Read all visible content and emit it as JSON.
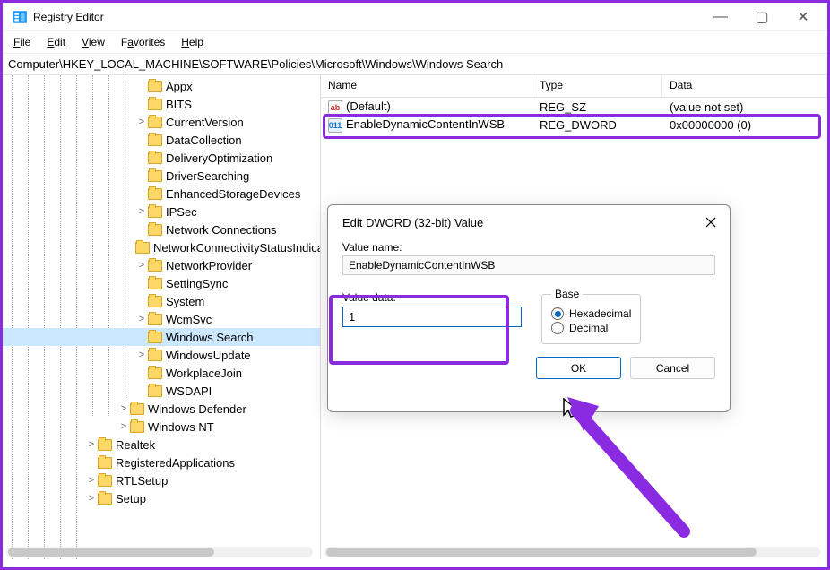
{
  "window": {
    "title": "Registry Editor",
    "min_icon": "—",
    "max_icon": "▢",
    "close_icon": "✕"
  },
  "menu": {
    "file": "File",
    "edit": "Edit",
    "view": "View",
    "favorites": "Favorites",
    "help": "Help"
  },
  "path": "Computer\\HKEY_LOCAL_MACHINE\\SOFTWARE\\Policies\\Microsoft\\Windows\\Windows Search",
  "tree": [
    {
      "indent": 148,
      "toggle": "",
      "label": "Appx"
    },
    {
      "indent": 148,
      "toggle": "",
      "label": "BITS"
    },
    {
      "indent": 148,
      "toggle": ">",
      "label": "CurrentVersion"
    },
    {
      "indent": 148,
      "toggle": "",
      "label": "DataCollection"
    },
    {
      "indent": 148,
      "toggle": "",
      "label": "DeliveryOptimization"
    },
    {
      "indent": 148,
      "toggle": "",
      "label": "DriverSearching"
    },
    {
      "indent": 148,
      "toggle": "",
      "label": "EnhancedStorageDevices"
    },
    {
      "indent": 148,
      "toggle": ">",
      "label": "IPSec"
    },
    {
      "indent": 148,
      "toggle": "",
      "label": "Network Connections"
    },
    {
      "indent": 148,
      "toggle": "",
      "label": "NetworkConnectivityStatusIndicator"
    },
    {
      "indent": 148,
      "toggle": ">",
      "label": "NetworkProvider"
    },
    {
      "indent": 148,
      "toggle": "",
      "label": "SettingSync"
    },
    {
      "indent": 148,
      "toggle": "",
      "label": "System"
    },
    {
      "indent": 148,
      "toggle": ">",
      "label": "WcmSvc"
    },
    {
      "indent": 148,
      "toggle": "",
      "label": "Windows Search",
      "selected": true
    },
    {
      "indent": 148,
      "toggle": ">",
      "label": "WindowsUpdate"
    },
    {
      "indent": 148,
      "toggle": "",
      "label": "WorkplaceJoin"
    },
    {
      "indent": 148,
      "toggle": "",
      "label": "WSDAPI"
    },
    {
      "indent": 128,
      "toggle": ">",
      "label": "Windows Defender"
    },
    {
      "indent": 128,
      "toggle": ">",
      "label": "Windows NT"
    },
    {
      "indent": 92,
      "toggle": ">",
      "label": "Realtek"
    },
    {
      "indent": 92,
      "toggle": "",
      "label": "RegisteredApplications"
    },
    {
      "indent": 92,
      "toggle": ">",
      "label": "RTLSetup"
    },
    {
      "indent": 92,
      "toggle": ">",
      "label": "Setup"
    }
  ],
  "list": {
    "headers": {
      "name": "Name",
      "type": "Type",
      "data": "Data"
    },
    "rows": [
      {
        "icon": "ab",
        "name": "(Default)",
        "type": "REG_SZ",
        "data": "(value not set)"
      },
      {
        "icon": "num",
        "name": "EnableDynamicContentInWSB",
        "type": "REG_DWORD",
        "data": "0x00000000 (0)",
        "highlighted": true
      }
    ]
  },
  "dialog": {
    "title": "Edit DWORD (32-bit) Value",
    "value_name_label": "Value name:",
    "value_name": "EnableDynamicContentInWSB",
    "value_data_label": "Value data:",
    "value_data": "1",
    "base_label": "Base",
    "hex_label": "Hexadecimal",
    "dec_label": "Decimal",
    "ok": "OK",
    "cancel": "Cancel"
  }
}
